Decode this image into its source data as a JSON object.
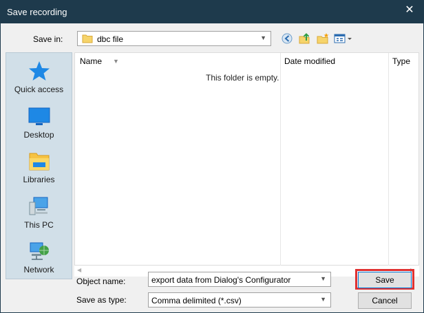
{
  "window": {
    "title": "Save recording",
    "close_glyph": "✕"
  },
  "location": {
    "label": "Save in:",
    "value": "dbc file"
  },
  "toolbar": {
    "icons": [
      "back-icon",
      "up-folder-icon",
      "new-folder-icon",
      "view-menu-icon"
    ]
  },
  "places": [
    {
      "label": "Quick access",
      "icon": "star-icon"
    },
    {
      "label": "Desktop",
      "icon": "desktop-icon"
    },
    {
      "label": "Libraries",
      "icon": "libraries-icon"
    },
    {
      "label": "This PC",
      "icon": "computer-icon"
    },
    {
      "label": "Network",
      "icon": "network-icon"
    }
  ],
  "filelist": {
    "columns": [
      "Name",
      "Date modified",
      "Type"
    ],
    "empty_message": "This folder is empty."
  },
  "fields": {
    "object_name_label": "Object name:",
    "object_name_value": "export data from Dialog's Configurator",
    "type_label": "Save as type:",
    "type_value": "Comma delimited (*.csv)"
  },
  "buttons": {
    "save": "Save",
    "cancel": "Cancel"
  },
  "colors": {
    "titlebar": "#1e3a4c",
    "highlight": "#e03131",
    "places_bg": "#d1dfe8"
  }
}
